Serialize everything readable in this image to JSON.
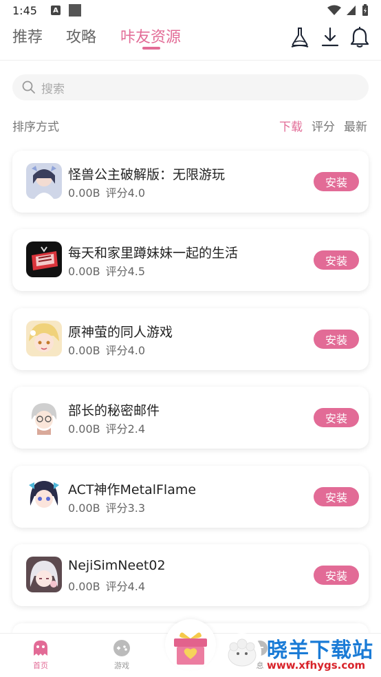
{
  "status": {
    "time": "1:45",
    "a_badge": "A"
  },
  "tabs": [
    {
      "label": "推荐",
      "active": false
    },
    {
      "label": "攻略",
      "active": false
    },
    {
      "label": "咔友资源",
      "active": true
    }
  ],
  "header_icons": [
    "flask-icon",
    "download-icon",
    "bell-icon"
  ],
  "search": {
    "placeholder": "搜索"
  },
  "sort": {
    "label": "排序方式",
    "options": [
      {
        "label": "下载",
        "active": true
      },
      {
        "label": "评分",
        "active": false
      },
      {
        "label": "最新",
        "active": false
      }
    ]
  },
  "apps": [
    {
      "title": "怪兽公主破解版：无限游玩",
      "size": "0.00B",
      "rating": "评分4.0",
      "button": "安装"
    },
    {
      "title": "每天和家里蹲妹妹一起的生活",
      "size": "0.00B",
      "rating": "评分4.5",
      "button": "安装"
    },
    {
      "title": "原神萤的同人游戏",
      "size": "0.00B",
      "rating": "评分4.0",
      "button": "安装"
    },
    {
      "title": "部长的秘密邮件",
      "size": "0.00B",
      "rating": "评分2.4",
      "button": "安装"
    },
    {
      "title": "ACT神作MetalFlame",
      "size": "0.00B",
      "rating": "评分3.3",
      "button": "安装"
    },
    {
      "title": "NejiSimNeet02",
      "size": "0.00B",
      "rating": "评分4.4",
      "button": "安装"
    }
  ],
  "bottom_nav": [
    {
      "label": "首页",
      "icon": "ghost-icon",
      "active": true
    },
    {
      "label": "游戏",
      "icon": "gamepad-icon",
      "active": false
    },
    {
      "label": "",
      "icon": "gift-icon",
      "active": false
    },
    {
      "label": "息",
      "icon": "message-icon",
      "active": false
    }
  ],
  "watermark": {
    "title": "晓羊下载站",
    "url": "www.xfhygs.com"
  },
  "colors": {
    "accent": "#e26b96",
    "text": "#222222",
    "muted": "#777777",
    "watermark_blue": "#1a7bd6",
    "watermark_red": "#d8232a"
  }
}
